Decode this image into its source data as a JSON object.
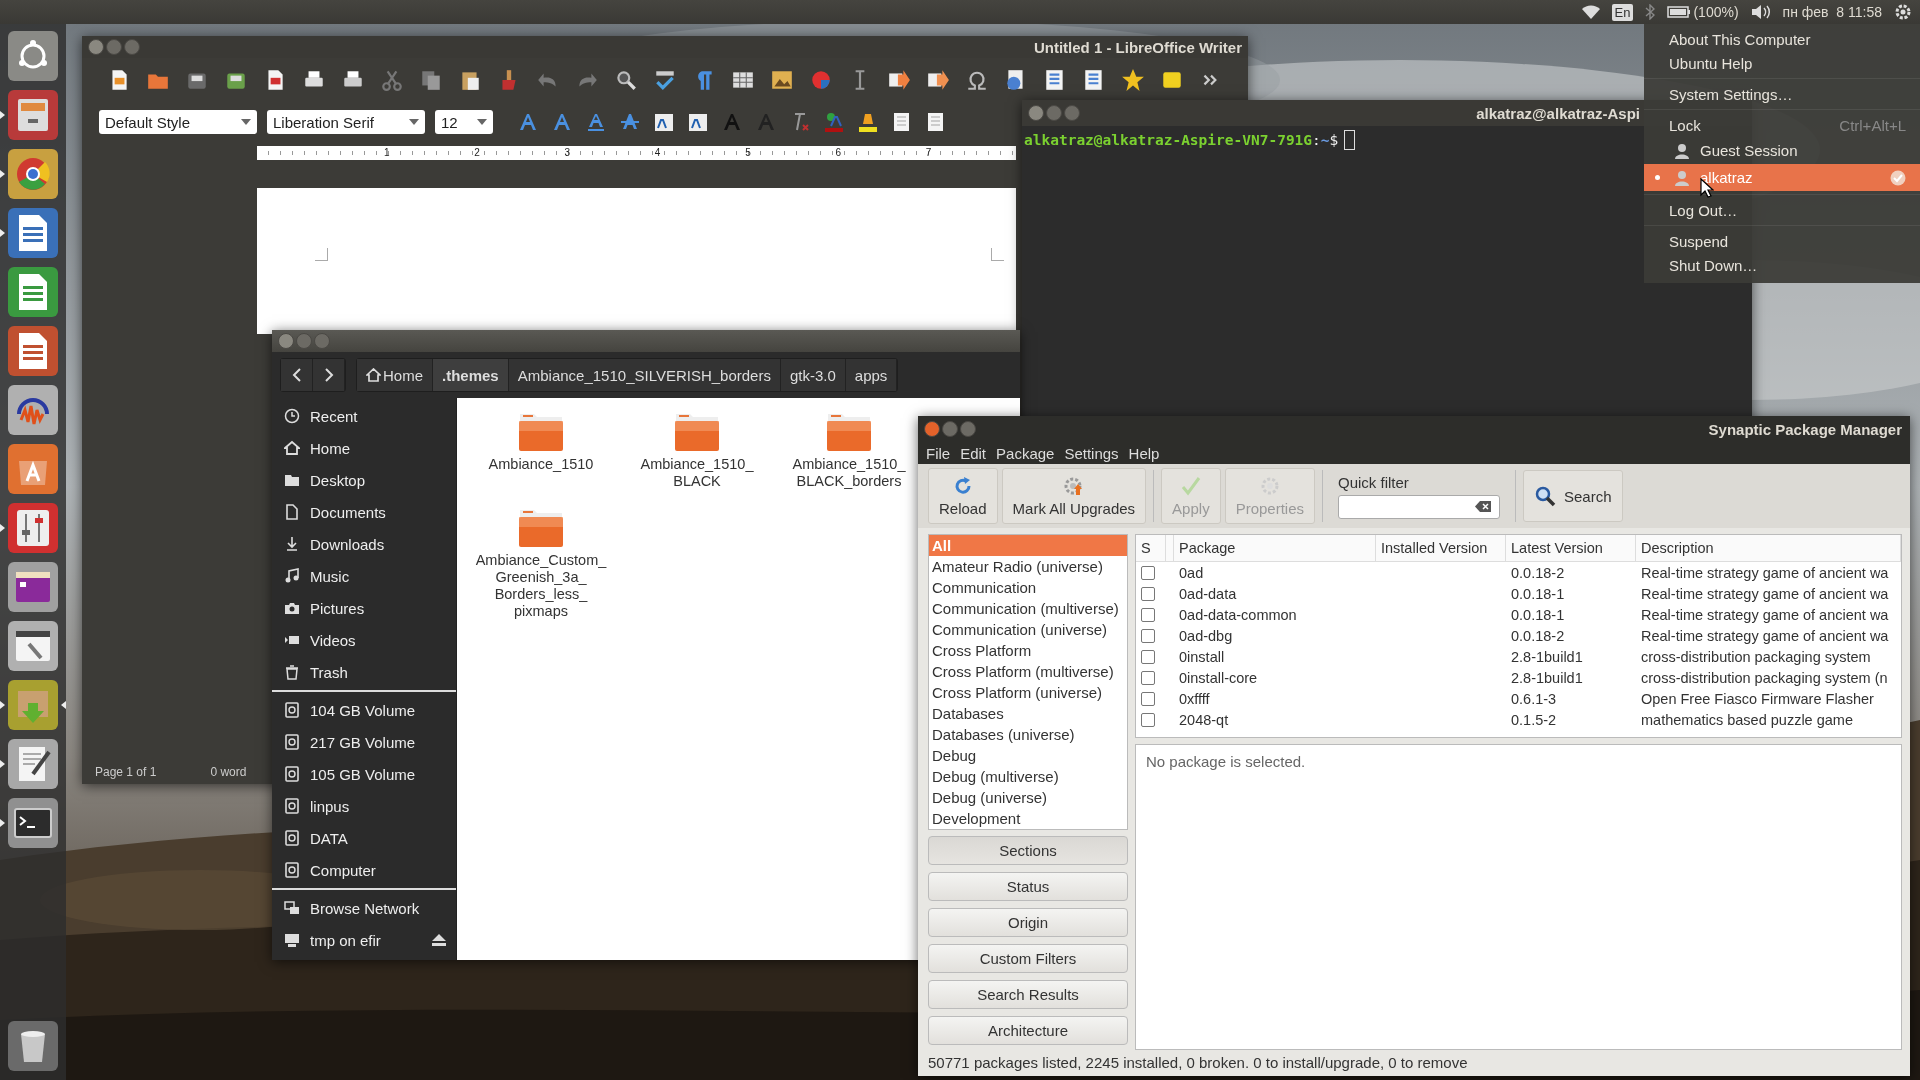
{
  "top_panel": {
    "keyboard_layout": "En",
    "battery": "(100%)",
    "clock": "пн фев  8 11:58"
  },
  "launcher": {
    "items": [
      {
        "kind": "dash",
        "running": false,
        "focused": false
      },
      {
        "kind": "files",
        "running": true,
        "focused": false
      },
      {
        "kind": "browser",
        "running": true,
        "focused": false
      },
      {
        "kind": "writer",
        "running": true,
        "focused": false
      },
      {
        "kind": "calc",
        "running": false,
        "focused": false
      },
      {
        "kind": "impress",
        "running": false,
        "focused": false
      },
      {
        "kind": "audio",
        "running": false,
        "focused": false
      },
      {
        "kind": "store",
        "running": false,
        "focused": false
      },
      {
        "kind": "mixer",
        "running": true,
        "focused": false
      },
      {
        "kind": "window",
        "running": false,
        "focused": false
      },
      {
        "kind": "settings",
        "running": false,
        "focused": false
      },
      {
        "kind": "installer",
        "running": true,
        "focused": true
      },
      {
        "kind": "editor",
        "running": true,
        "focused": false
      },
      {
        "kind": "terminal",
        "running": true,
        "focused": false
      }
    ]
  },
  "writer": {
    "title": "Untitled 1 - LibreOffice Writer",
    "paragraph_style": "Default Style",
    "font_name": "Liberation Serif",
    "font_size": "12",
    "ruler_labels": [
      "1",
      "2",
      "3",
      "4",
      "5",
      "6",
      "7"
    ],
    "status_bar": {
      "page": "Page 1 of 1",
      "words": "0 word"
    }
  },
  "terminal": {
    "title": "alkatraz@alkatraz-Aspi",
    "prompt": {
      "user_host": "alkatraz@alkatraz-Aspire-VN7-791G",
      "separator": ":",
      "path": "~",
      "symbol": "$"
    }
  },
  "files": {
    "path": [
      {
        "label": "Home",
        "kind": "home",
        "selected": false
      },
      {
        "label": ".themes",
        "kind": "plain",
        "selected": true
      },
      {
        "label": "Ambiance_1510_SILVERISH_borders",
        "kind": "plain",
        "selected": false
      },
      {
        "label": "gtk-3.0",
        "kind": "plain",
        "selected": false
      },
      {
        "label": "apps",
        "kind": "plain",
        "selected": false
      }
    ],
    "places": [
      {
        "label": "Recent",
        "kind": "recent"
      },
      {
        "label": "Home",
        "kind": "home"
      },
      {
        "label": "Desktop",
        "kind": "desktop"
      },
      {
        "label": "Documents",
        "kind": "document"
      },
      {
        "label": "Downloads",
        "kind": "download"
      },
      {
        "label": "Music",
        "kind": "music"
      },
      {
        "label": "Pictures",
        "kind": "camera"
      },
      {
        "label": "Videos",
        "kind": "video"
      },
      {
        "label": "Trash",
        "kind": "trash"
      }
    ],
    "devices": [
      {
        "label": "104 GB Volume",
        "kind": "drive"
      },
      {
        "label": "217 GB Volume",
        "kind": "drive"
      },
      {
        "label": "105 GB Volume",
        "kind": "drive"
      },
      {
        "label": "linpus",
        "kind": "drive"
      },
      {
        "label": "DATA",
        "kind": "drive"
      },
      {
        "label": "Computer",
        "kind": "drive"
      }
    ],
    "network": [
      {
        "label": "Browse Network",
        "kind": "network",
        "ejectable": false
      },
      {
        "label": "tmp on efir",
        "kind": "share",
        "ejectable": true
      }
    ],
    "items": [
      {
        "name": "Ambiance_1510"
      },
      {
        "name": "Ambiance_1510_BLACK"
      },
      {
        "name": "Ambiance_1510_BLACK_borders"
      },
      {
        "name": "Ambiance_Custom_Greenish_3a_Borders_less_pixmaps"
      }
    ]
  },
  "synaptic": {
    "title": "Synaptic Package Manager",
    "menu": [
      "File",
      "Edit",
      "Package",
      "Settings",
      "Help"
    ],
    "toolbar": [
      {
        "label": "Reload",
        "kind": "reload",
        "disabled": false
      },
      {
        "label": "Mark All Upgrades",
        "kind": "upgrade",
        "disabled": false
      },
      {
        "label": "Apply",
        "kind": "apply",
        "disabled": true
      },
      {
        "label": "Properties",
        "kind": "properties",
        "disabled": true
      }
    ],
    "quick_filter": {
      "label": "Quick filter"
    },
    "search": "Search",
    "sections": [
      {
        "label": "All",
        "selected": true
      },
      {
        "label": "Amateur Radio (universe)",
        "selected": false
      },
      {
        "label": "Communication",
        "selected": false
      },
      {
        "label": "Communication (multiverse)",
        "selected": false
      },
      {
        "label": "Communication (universe)",
        "selected": false
      },
      {
        "label": "Cross Platform",
        "selected": false
      },
      {
        "label": "Cross Platform (multiverse)",
        "selected": false
      },
      {
        "label": "Cross Platform (universe)",
        "selected": false
      },
      {
        "label": "Databases",
        "selected": false
      },
      {
        "label": "Databases (universe)",
        "selected": false
      },
      {
        "label": "Debug",
        "selected": false
      },
      {
        "label": "Debug (multiverse)",
        "selected": false
      },
      {
        "label": "Debug (universe)",
        "selected": false
      },
      {
        "label": "Development",
        "selected": false
      }
    ],
    "filter_buttons": [
      {
        "label": "Sections",
        "selected": true
      },
      {
        "label": "Status",
        "selected": false
      },
      {
        "label": "Origin",
        "selected": false
      },
      {
        "label": "Custom Filters",
        "selected": false
      },
      {
        "label": "Search Results",
        "selected": false
      },
      {
        "label": "Architecture",
        "selected": false
      }
    ],
    "columns": [
      "S",
      "Package",
      "Installed Version",
      "Latest Version",
      "Description"
    ],
    "rows": [
      {
        "checked": false,
        "package": "0ad",
        "latest_version": "0.0.18-2",
        "description": "Real-time strategy game of ancient wa"
      },
      {
        "checked": false,
        "package": "0ad-data",
        "latest_version": "0.0.18-1",
        "description": "Real-time strategy game of ancient wa"
      },
      {
        "checked": false,
        "package": "0ad-data-common",
        "latest_version": "0.0.18-1",
        "description": "Real-time strategy game of ancient wa"
      },
      {
        "checked": false,
        "package": "0ad-dbg",
        "latest_version": "0.0.18-2",
        "description": "Real-time strategy game of ancient wa"
      },
      {
        "checked": false,
        "package": "0install",
        "latest_version": "2.8-1build1",
        "description": "cross-distribution packaging system"
      },
      {
        "checked": false,
        "package": "0install-core",
        "latest_version": "2.8-1build1",
        "description": "cross-distribution packaging system (n"
      },
      {
        "checked": false,
        "package": "0xffff",
        "latest_version": "0.6.1-3",
        "description": "Open Free Fiasco Firmware Flasher"
      },
      {
        "checked": false,
        "package": "2048-qt",
        "latest_version": "0.1.5-2",
        "description": "mathematics based puzzle game"
      }
    ],
    "details": "No package is selected.",
    "status_bar": "50771 packages listed, 2245 installed, 0 broken. 0 to install/upgrade, 0 to remove"
  },
  "session_menu": {
    "items": [
      {
        "kind": "item",
        "label": "About This Computer"
      },
      {
        "kind": "item",
        "label": "Ubuntu Help"
      },
      {
        "kind": "separator"
      },
      {
        "kind": "item",
        "label": "System Settings…"
      },
      {
        "kind": "separator"
      },
      {
        "kind": "item",
        "label": "Lock",
        "shortcut": "Ctrl+Alt+L"
      },
      {
        "kind": "user",
        "label": "Guest Session",
        "selected": false
      },
      {
        "kind": "user",
        "label": "alkatraz",
        "selected": true
      },
      {
        "kind": "separator"
      },
      {
        "kind": "item",
        "label": "Log Out…"
      },
      {
        "kind": "separator"
      },
      {
        "kind": "item",
        "label": "Suspend"
      },
      {
        "kind": "item",
        "label": "Shut Down…"
      }
    ]
  }
}
